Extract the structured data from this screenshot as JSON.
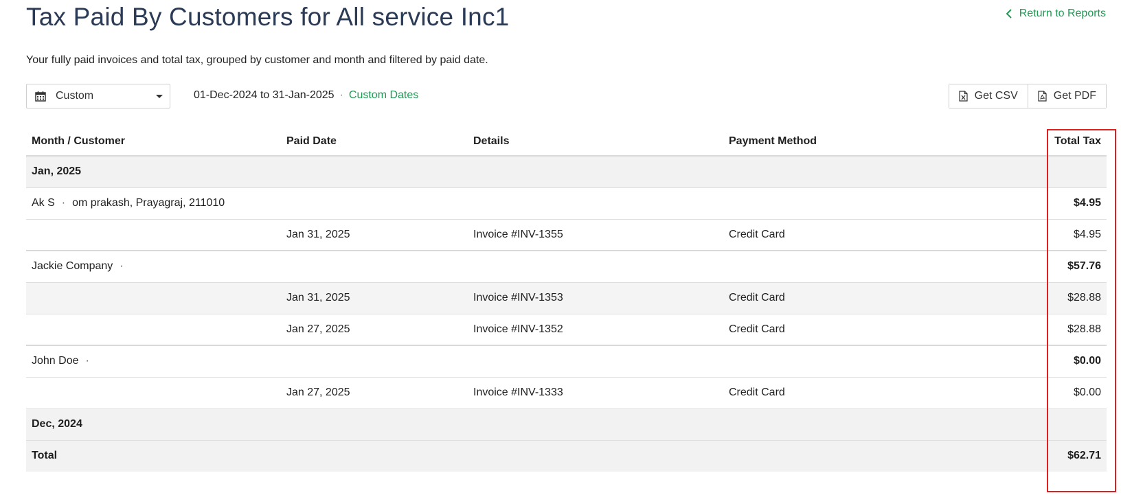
{
  "header": {
    "title": "Tax Paid By Customers for All service Inc1",
    "return_label": "Return to Reports",
    "subtitle": "Your fully paid invoices and total tax, grouped by customer and month and filtered by paid date."
  },
  "toolbar": {
    "range_label": "Custom",
    "date_range": "01-Dec-2024 to 31-Jan-2025",
    "separator": "·",
    "custom_dates_label": "Custom Dates",
    "csv_label": "Get CSV",
    "pdf_label": "Get PDF"
  },
  "table": {
    "columns": [
      "Month / Customer",
      "Paid Date",
      "Details",
      "Payment Method",
      "Total Tax"
    ],
    "month1": "Jan, 2025",
    "customers": [
      {
        "name": "Ak S",
        "address": "om prakash, Prayagraj, 211010",
        "total": "$4.95",
        "rows": [
          {
            "paid_date": "Jan 31, 2025",
            "details": "Invoice #INV-1355",
            "method": "Credit Card",
            "tax": "$4.95"
          }
        ]
      },
      {
        "name": "Jackie Company",
        "address": "",
        "total": "$57.76",
        "rows": [
          {
            "paid_date": "Jan 31, 2025",
            "details": "Invoice #INV-1353",
            "method": "Credit Card",
            "tax": "$28.88"
          },
          {
            "paid_date": "Jan 27, 2025",
            "details": "Invoice #INV-1352",
            "method": "Credit Card",
            "tax": "$28.88"
          }
        ]
      },
      {
        "name": "John Doe",
        "address": "",
        "total": "$0.00",
        "rows": [
          {
            "paid_date": "Jan 27, 2025",
            "details": "Invoice #INV-1333",
            "method": "Credit Card",
            "tax": "$0.00"
          }
        ]
      }
    ],
    "month2": "Dec, 2024",
    "total_label": "Total",
    "total_value": "$62.71"
  },
  "colors": {
    "accent": "#1f9a52",
    "title": "#2b3a55",
    "highlight": "#e02020"
  }
}
